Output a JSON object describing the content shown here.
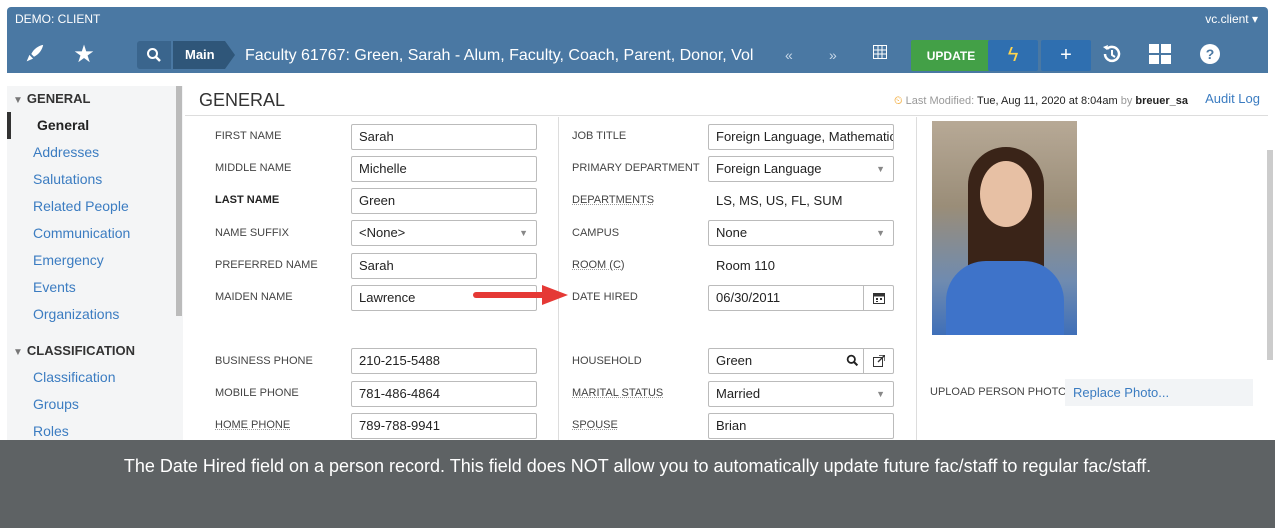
{
  "app": {
    "org": "DEMO: CLIENT",
    "user": "vc.client ▾"
  },
  "toolbar": {
    "breadcrumb": "Main",
    "record_title": "Faculty 61767: Green, Sarah - Alum, Faculty, Coach, Parent, Donor, Vol",
    "update_label": "UPDATE",
    "icons": [
      "rocket-icon",
      "star-icon",
      "search-icon",
      "grid-icon",
      "bolt-icon",
      "plus-icon",
      "history-icon",
      "apps-icon",
      "help-icon"
    ]
  },
  "sidebar": {
    "general_header": "GENERAL",
    "general_items": [
      "General",
      "Addresses",
      "Salutations",
      "Related People",
      "Communication",
      "Emergency",
      "Events",
      "Organizations"
    ],
    "classification_header": "CLASSIFICATION",
    "classification_items": [
      "Classification",
      "Groups",
      "Roles"
    ]
  },
  "header": {
    "title": "GENERAL",
    "last_mod_label": "Last Modified:",
    "last_mod_date": "Tue, Aug 11, 2020 at 8:04am",
    "by": "by",
    "last_mod_user": "breuer_sa",
    "audit": "Audit Log"
  },
  "form": {
    "first_name": {
      "label": "FIRST NAME",
      "value": "Sarah"
    },
    "middle_name": {
      "label": "MIDDLE NAME",
      "value": "Michelle"
    },
    "last_name": {
      "label": "LAST NAME",
      "value": "Green"
    },
    "name_suffix": {
      "label": "NAME SUFFIX",
      "value": "<None>"
    },
    "preferred_name": {
      "label": "PREFERRED NAME",
      "value": "Sarah"
    },
    "maiden_name": {
      "label": "MAIDEN NAME",
      "value": "Lawrence"
    },
    "business_phone": {
      "label": "BUSINESS PHONE",
      "value": "210-215-5488"
    },
    "mobile_phone": {
      "label": "MOBILE PHONE",
      "value": "781-486-4864"
    },
    "home_phone": {
      "label": "HOME PHONE",
      "value": "789-788-9941"
    },
    "job_title": {
      "label": "JOB TITLE",
      "value": "Foreign Language, Mathematics T"
    },
    "primary_department": {
      "label": "PRIMARY DEPARTMENT",
      "value": "Foreign Language"
    },
    "departments": {
      "label": "DEPARTMENTS",
      "value": "LS, MS, US, FL, SUM"
    },
    "campus": {
      "label": "CAMPUS",
      "value": "None"
    },
    "room": {
      "label": "ROOM (C)",
      "value": "Room 110"
    },
    "date_hired": {
      "label": "DATE HIRED",
      "value": "06/30/2011"
    },
    "household": {
      "label": "HOUSEHOLD",
      "value": "Green"
    },
    "marital_status": {
      "label": "MARITAL STATUS",
      "value": "Married"
    },
    "spouse": {
      "label": "SPOUSE",
      "value": "Brian"
    },
    "upload_label": "UPLOAD PERSON PHOTO",
    "replace_photo": "Replace Photo..."
  },
  "caption": "The Date Hired field on a person record. This field does NOT allow you to automatically update future fac/staff to regular fac/staff."
}
